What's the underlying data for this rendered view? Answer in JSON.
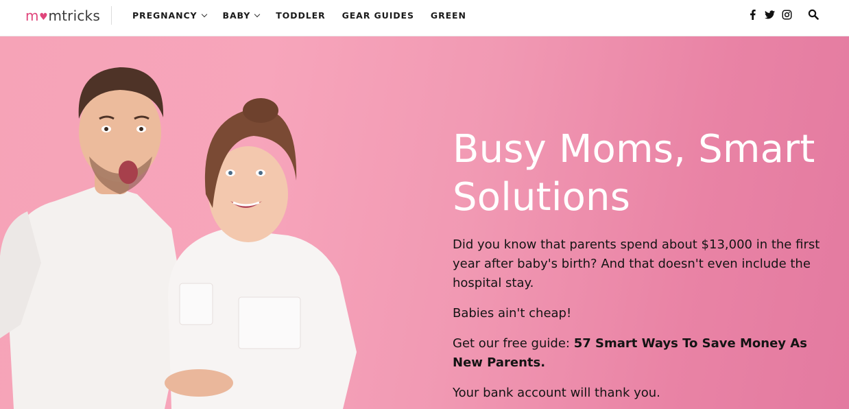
{
  "brand": {
    "logo_prefix": "m",
    "logo_heart": "♥",
    "logo_suffix": "mtricks",
    "accent_color": "#e0457b"
  },
  "nav": {
    "items": [
      {
        "label": "PREGNANCY",
        "has_dropdown": true
      },
      {
        "label": "BABY",
        "has_dropdown": true
      },
      {
        "label": "TODDLER",
        "has_dropdown": false
      },
      {
        "label": "GEAR GUIDES",
        "has_dropdown": false
      },
      {
        "label": "GREEN",
        "has_dropdown": false
      }
    ]
  },
  "social": {
    "icons": [
      "facebook-icon",
      "twitter-icon",
      "instagram-icon"
    ]
  },
  "search": {
    "icon": "search-icon"
  },
  "hero": {
    "background_color": "#f4a0b8",
    "title": "Busy Moms, Smart Solutions",
    "paragraph_1": "Did you know that parents spend about $13,000 in the first year after baby's birth? And that doesn't even include the hospital stay.",
    "paragraph_2": "Babies ain't cheap!",
    "paragraph_3_prefix": "Get our free guide: ",
    "paragraph_3_bold": "57 Smart Ways To Save Money As New Parents.",
    "paragraph_4": "Your bank account will thank you."
  }
}
